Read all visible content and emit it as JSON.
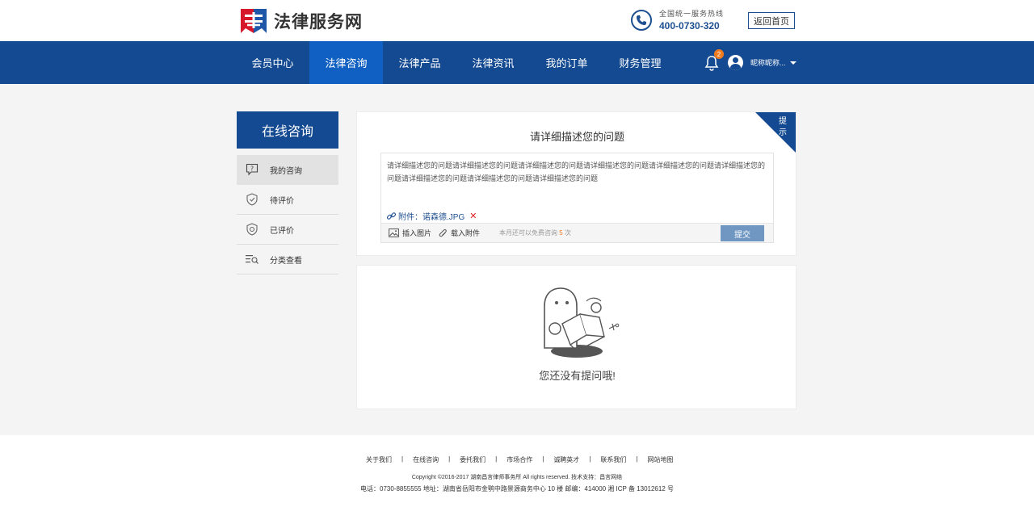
{
  "header": {
    "logo_text": "法律服务网",
    "hotline_label": "全国统一服务热线",
    "hotline_number": "400-0730-320",
    "home_button": "返回首页"
  },
  "nav": {
    "items": [
      {
        "label": "会员中心"
      },
      {
        "label": "法律咨询"
      },
      {
        "label": "法律产品"
      },
      {
        "label": "法律资讯"
      },
      {
        "label": "我的订单"
      },
      {
        "label": "财务管理"
      }
    ],
    "active_index": 1,
    "notification_count": "2",
    "user_name": "昵称昵称..."
  },
  "sidebar": {
    "title": "在线咨询",
    "items": [
      {
        "label": "我的咨询",
        "icon": "question-bubble-icon"
      },
      {
        "label": "待评价",
        "icon": "shield-pending-icon"
      },
      {
        "label": "已评价",
        "icon": "shield-check-icon"
      },
      {
        "label": "分类查看",
        "icon": "list-search-icon"
      }
    ]
  },
  "question": {
    "title": "请详细描述您的问题",
    "tip_label": "提示",
    "content": "请详细描述您的问题请详细描述您的问题请详细描述您的问题请详细描述您的问题请详细描述您的问题请详细描述您的问题请详细描述您的问题请详细描述您的问题请详细描述您的问题",
    "attachment_label": "附件：",
    "attachment_name": "诺森德.JPG",
    "insert_image": "插入图片",
    "load_attachment": "载入附件",
    "quota_prefix": "本月还可以免费咨询",
    "quota_count": "5",
    "quota_suffix": "次",
    "submit": "提交"
  },
  "empty": {
    "message": "您还没有提问哦!"
  },
  "footer": {
    "links": [
      "关于我们",
      "在线咨询",
      "委托我们",
      "市场合作",
      "诚聘英才",
      "联系我们",
      "网站地图"
    ],
    "copyright": "Copyright ©2016-2017 湖南昌言律师事务所 All rights reserved. 技术支持：昌言网络",
    "address": "电话：0730-8855555 地址：湖南省岳阳市金鹗中路景源商务中心 10 楼  邮编：414000  湘 ICP 备 13012612 号"
  },
  "colors": {
    "primary": "#144a92",
    "nav_active": "#0f60c2",
    "badge": "#f07a1e",
    "submit": "#6f97c2",
    "logo_red": "#d7182a",
    "logo_blue": "#1e56a8"
  }
}
